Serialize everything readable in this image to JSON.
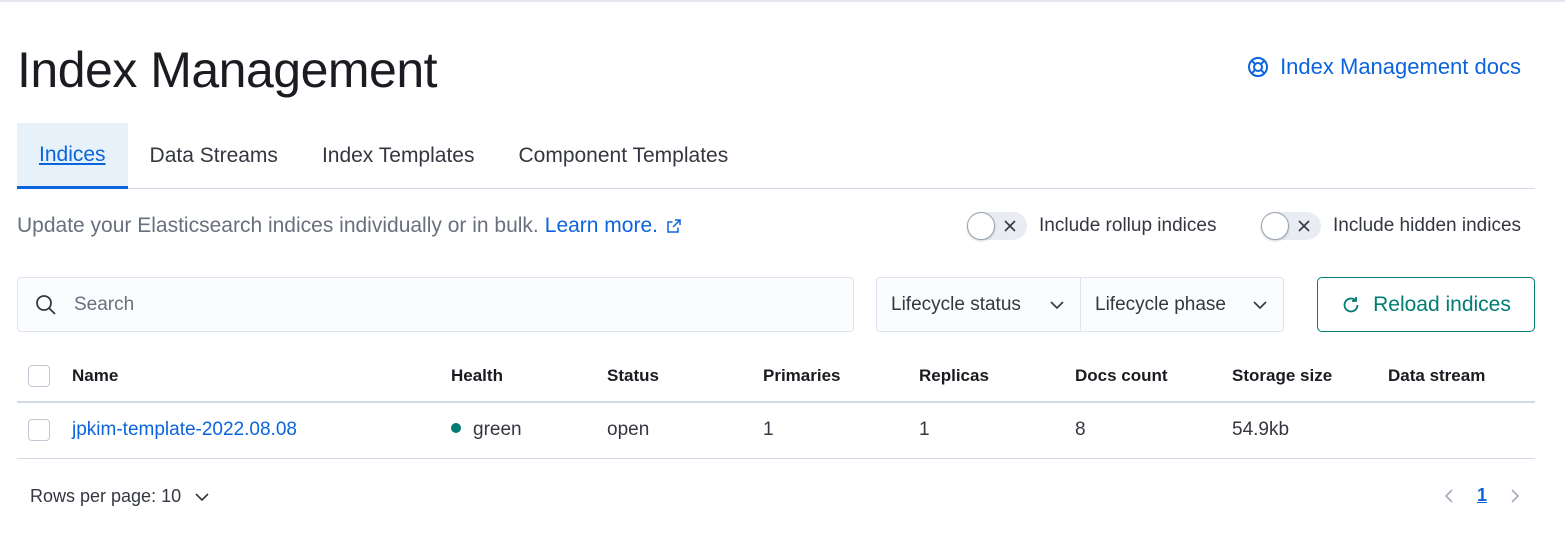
{
  "header": {
    "title": "Index Management",
    "docs_link": "Index Management docs"
  },
  "tabs": [
    {
      "label": "Indices",
      "active": true
    },
    {
      "label": "Data Streams",
      "active": false
    },
    {
      "label": "Index Templates",
      "active": false
    },
    {
      "label": "Component Templates",
      "active": false
    }
  ],
  "description": {
    "text": "Update your Elasticsearch indices individually or in bulk.",
    "link": "Learn more."
  },
  "toggles": [
    {
      "label": "Include rollup indices",
      "on": false
    },
    {
      "label": "Include hidden indices",
      "on": false
    }
  ],
  "search": {
    "placeholder": "Search",
    "value": ""
  },
  "filters": [
    {
      "label": "Lifecycle status"
    },
    {
      "label": "Lifecycle phase"
    }
  ],
  "reload_button": "Reload indices",
  "table": {
    "columns": [
      "Name",
      "Health",
      "Status",
      "Primaries",
      "Replicas",
      "Docs count",
      "Storage size",
      "Data stream"
    ],
    "rows": [
      {
        "name": "jpkim-template-2022.08.08",
        "health": "green",
        "status": "open",
        "primaries": "1",
        "replicas": "1",
        "docs_count": "8",
        "storage_size": "54.9kb",
        "data_stream": ""
      }
    ]
  },
  "pagination": {
    "rows_per_page": "Rows per page: 10",
    "current_page": "1"
  },
  "colors": {
    "link": "#0b64dd",
    "health_green": "#017d73",
    "reload": "#017d73",
    "active_tab_bg": "#e6f1fa"
  },
  "icons": {
    "docs": "help-lifebuoy-icon",
    "external": "external-link-icon",
    "search": "search-icon",
    "chevron": "chevron-down-icon",
    "reload": "refresh-icon"
  }
}
